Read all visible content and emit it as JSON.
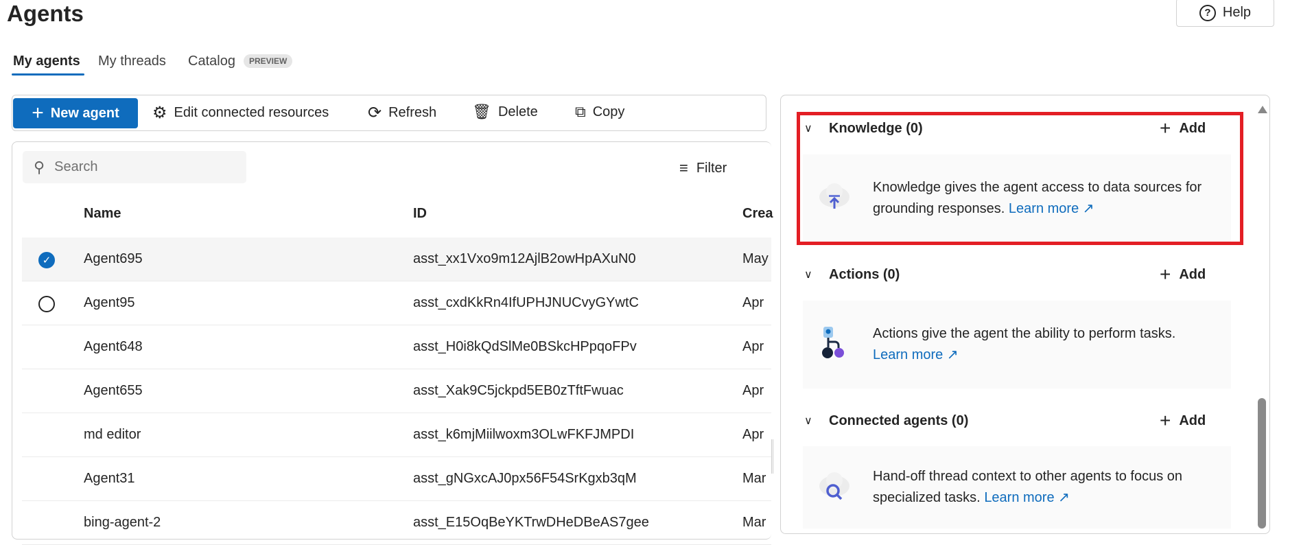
{
  "page": {
    "title": "Agents",
    "help_label": "Help"
  },
  "tabs": [
    {
      "label": "My agents",
      "active": true
    },
    {
      "label": "My threads"
    },
    {
      "label": "Catalog",
      "badge": "PREVIEW"
    }
  ],
  "toolbar": {
    "new_agent": "New agent",
    "edit_resources": "Edit connected resources",
    "refresh": "Refresh",
    "delete": "Delete",
    "copy": "Copy"
  },
  "list": {
    "search_placeholder": "Search",
    "filter_label": "Filter",
    "columns": [
      "Name",
      "ID",
      "Crea"
    ],
    "rows": [
      {
        "name": "Agent695",
        "id": "asst_xx1Vxo9m12AjlB2owHpAXuN0",
        "created": "May",
        "selected": true
      },
      {
        "name": "Agent95",
        "id": "asst_cxdKkRn4IfUPHJNUCvyGYwtC",
        "created": "Apr"
      },
      {
        "name": "Agent648",
        "id": "asst_H0i8kQdSlMe0BSkcHPpqoFPv",
        "created": "Apr"
      },
      {
        "name": "Agent655",
        "id": "asst_Xak9C5jckpd5EB0zTftFwuac",
        "created": "Apr"
      },
      {
        "name": "md editor",
        "id": "asst_k6mjMiilwoxm3OLwFKFJMPDI",
        "created": "Apr"
      },
      {
        "name": "Agent31",
        "id": "asst_gNGxcAJ0px56F54SrKgxb3qM",
        "created": "Mar"
      },
      {
        "name": "bing-agent-2",
        "id": "asst_E15OqBeYKTrwDHeDBeAS7gee",
        "created": "Mar"
      }
    ]
  },
  "sections": [
    {
      "title": "Knowledge (0)",
      "add": "Add",
      "text": "Knowledge gives the agent access to data sources for grounding responses.",
      "link": "Learn more"
    },
    {
      "title": "Actions (0)",
      "add": "Add",
      "text": "Actions give the agent the ability to perform tasks.",
      "link": "Learn more"
    },
    {
      "title": "Connected agents (0)",
      "add": "Add",
      "text": "Hand-off thread context to other agents to focus on specialized tasks.",
      "link": "Learn more"
    }
  ],
  "colors": {
    "accent": "#0f6cbd",
    "highlight": "#e31e24"
  }
}
